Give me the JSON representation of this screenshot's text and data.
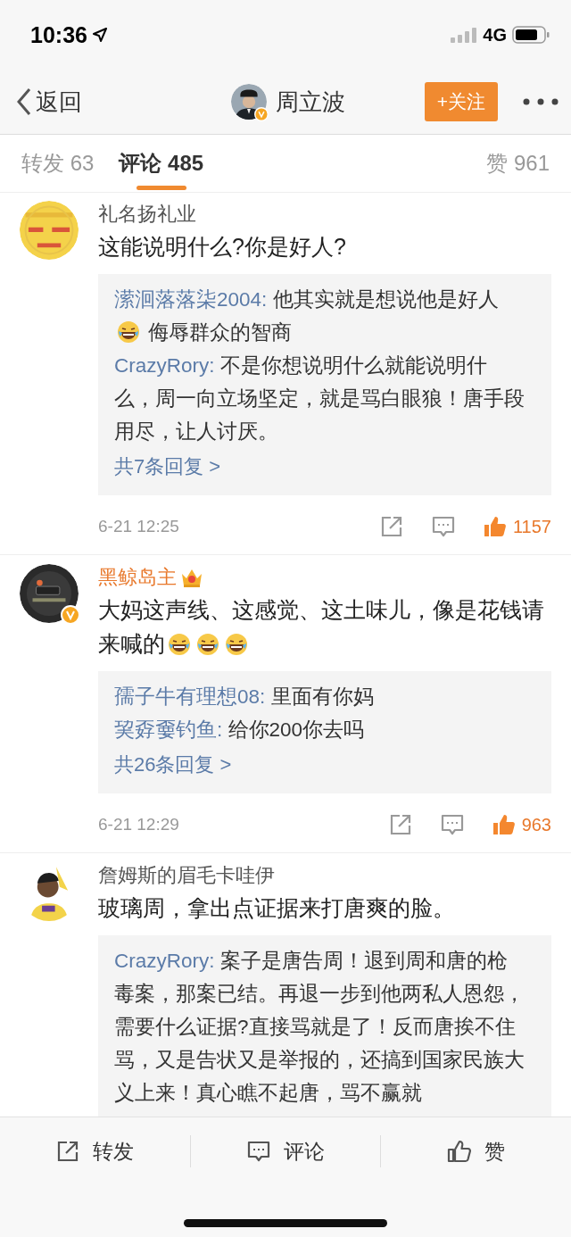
{
  "status_bar": {
    "time": "10:36",
    "network": "4G"
  },
  "nav": {
    "back": "返回",
    "user": {
      "name": "周立波",
      "verified": true
    },
    "follow": "+关注"
  },
  "tabs": [
    {
      "label": "转发 63",
      "selected": false
    },
    {
      "label": "评论 485",
      "selected": true
    },
    {
      "label": "赞 961",
      "selected": false
    }
  ],
  "comments": [
    {
      "user": "礼名扬礼业",
      "vip": false,
      "verified": false,
      "content": [
        {
          "kind": "text",
          "text": "这能说明什么?你是好人?"
        }
      ],
      "replies": [
        {
          "user": "潆洄落落柒2004:",
          "content": [
            {
              "kind": "text",
              "text": "他其实就是想说他是好人"
            },
            {
              "kind": "emoji"
            },
            {
              "kind": "text",
              "text": " 侮辱群众的智商"
            }
          ]
        },
        {
          "user": "CrazyRory:",
          "content": [
            {
              "kind": "text",
              "text": "不是你想说明什么就能说明什么，周一向立场坚定，就是骂白眼狼！唐手段用尽，让人讨厌。"
            }
          ]
        }
      ],
      "more": "共7条回复 >",
      "time": "6-21 12:25",
      "likes": "1157",
      "liked": true
    },
    {
      "user": "黑鲸岛主",
      "vip": true,
      "verified": true,
      "content": [
        {
          "kind": "text",
          "text": "大妈这声线、这感觉、这土味儿，像是花钱请来喊的"
        },
        {
          "kind": "emoji"
        },
        {
          "kind": "emoji"
        },
        {
          "kind": "emoji"
        }
      ],
      "replies": [
        {
          "user": "孺子牛有理想08:",
          "content": [
            {
              "kind": "text",
              "text": "里面有你妈"
            }
          ]
        },
        {
          "user": "巭孬嫑钓鱼:",
          "content": [
            {
              "kind": "text",
              "text": "给你200你去吗"
            }
          ]
        }
      ],
      "more": "共26条回复 >",
      "time": "6-21 12:29",
      "likes": "963",
      "liked": true
    },
    {
      "user": "詹姆斯的眉毛卡哇伊",
      "vip": false,
      "verified": false,
      "content": [
        {
          "kind": "text",
          "text": "玻璃周，拿出点证据来打唐爽的脸。"
        }
      ],
      "replies": [
        {
          "user": "CrazyRory:",
          "content": [
            {
              "kind": "text",
              "text": "案子是唐告周！退到周和唐的枪毒案，那案已结。再退一步到他两私人恩怨，需要什么证据?直接骂就是了！反而唐挨不住骂，又是告状又是举报的，还搞到国家民族大义上来！真心瞧不起唐，骂不赢就"
            }
          ]
        }
      ]
    }
  ],
  "bottom_bar": [
    {
      "kind": "repost",
      "label": "转发"
    },
    {
      "kind": "comment",
      "label": "评论"
    },
    {
      "kind": "like",
      "label": "赞"
    }
  ]
}
